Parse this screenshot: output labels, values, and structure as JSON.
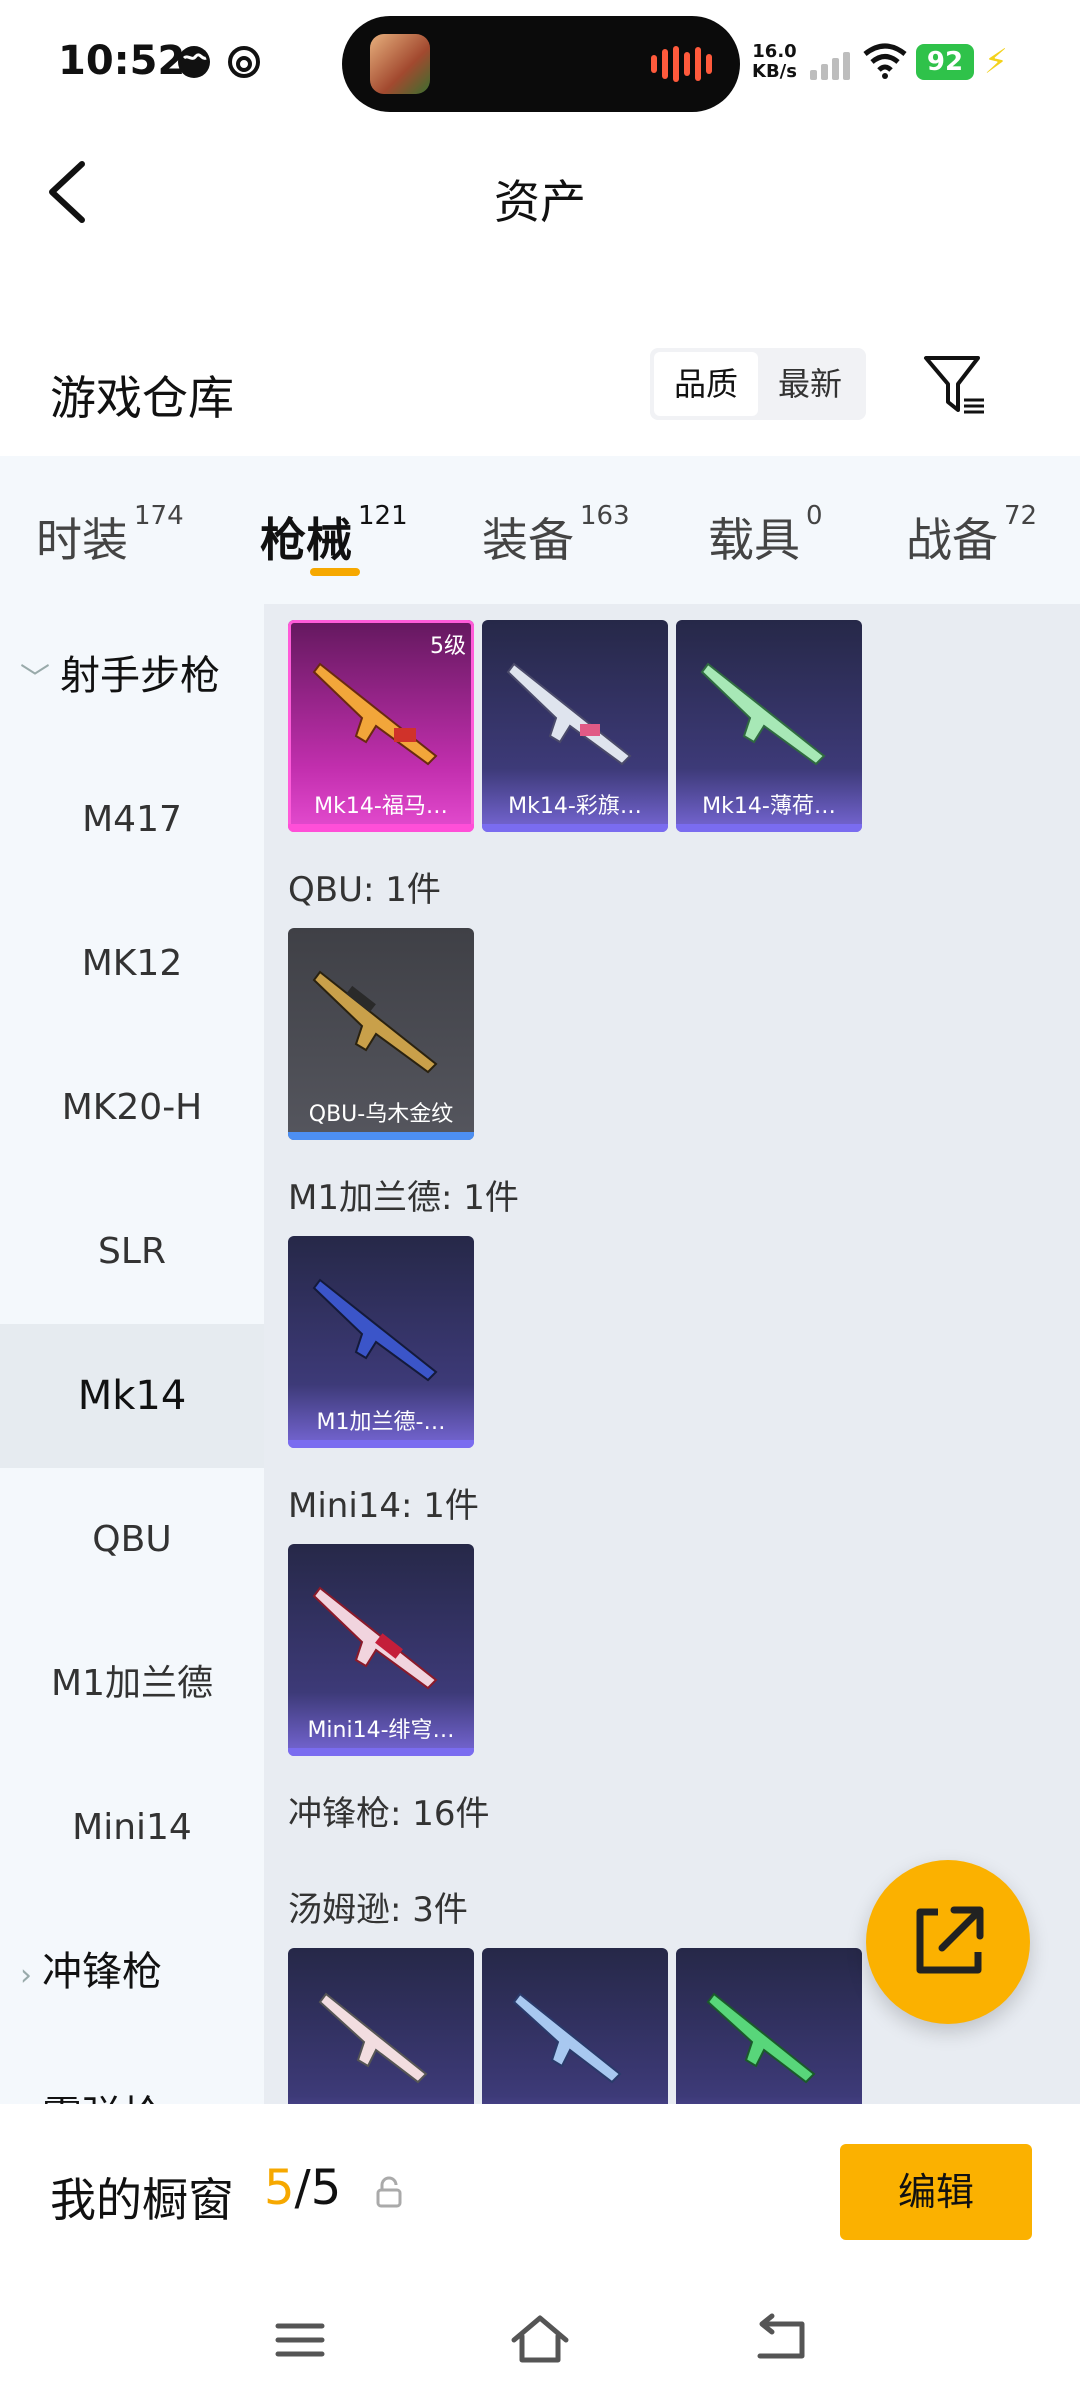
{
  "status_bar": {
    "time": "10:52",
    "net_speed_value": "16.0",
    "net_speed_unit": "KB/s",
    "battery": "92"
  },
  "header": {
    "title": "资产"
  },
  "warehouse": {
    "title": "游戏仓库",
    "sort_options": [
      "品质",
      "最新"
    ],
    "active_sort": "品质"
  },
  "tabs": [
    {
      "label": "时装",
      "count": "174"
    },
    {
      "label": "枪械",
      "count": "121",
      "active": true
    },
    {
      "label": "装备",
      "count": "163"
    },
    {
      "label": "载具",
      "count": "0"
    },
    {
      "label": "战备",
      "count": "72"
    }
  ],
  "sidebar": {
    "group_open": "射手步枪",
    "items": [
      "M417",
      "MK12",
      "MK20-H",
      "SLR",
      "Mk14",
      "QBU",
      "M1加兰德",
      "Mini14"
    ],
    "active_item": "Mk14",
    "group_closed": "冲锋枪",
    "group_cut": "霰弹枪"
  },
  "content": {
    "mk14_cards": [
      {
        "name": "Mk14-福马…",
        "level": "5级"
      },
      {
        "name": "Mk14-彩旗…"
      },
      {
        "name": "Mk14-薄荷…"
      }
    ],
    "qbu_label": "QBU: 1件",
    "qbu_cards": [
      {
        "name": "QBU-乌木金纹"
      }
    ],
    "m1_label": "M1加兰德: 1件",
    "m1_cards": [
      {
        "name": "M1加兰德-…"
      }
    ],
    "mini14_label": "Mini14: 1件",
    "mini14_cards": [
      {
        "name": "Mini14-绯穹…"
      }
    ],
    "smg_label": "冲锋枪: 16件",
    "thompson_label": "汤姆逊: 3件"
  },
  "showcase": {
    "label": "我的橱窗",
    "current": "5",
    "separator": "/",
    "total": "5",
    "edit_label": "编辑"
  },
  "colors": {
    "accent": "#fbb100",
    "tab_underline": "#f6a800",
    "battery": "#2fc24a"
  }
}
